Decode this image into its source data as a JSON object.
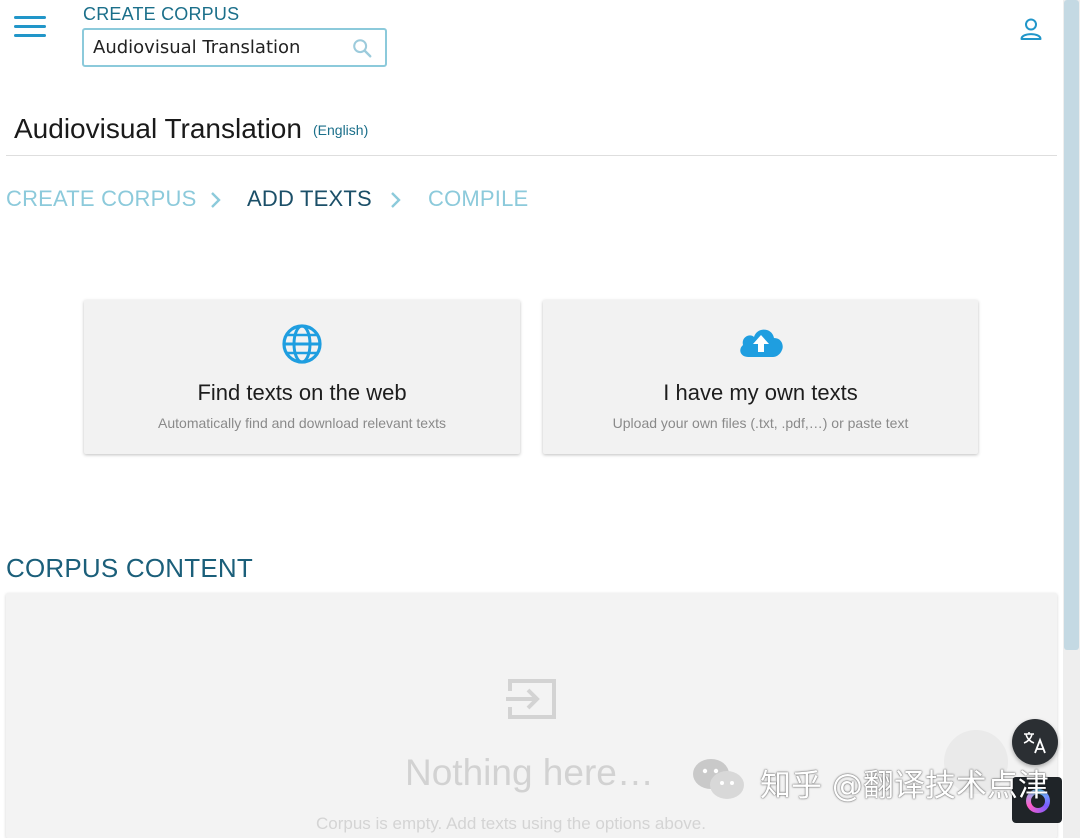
{
  "header": {
    "title": "CREATE CORPUS",
    "search": {
      "value": "Audiovisual Translation",
      "placeholder": ""
    }
  },
  "page": {
    "title": "Audiovisual Translation",
    "language": "(English)"
  },
  "stepper": {
    "steps": [
      {
        "label": "CREATE CORPUS",
        "state": "done"
      },
      {
        "label": "ADD TEXTS",
        "state": "active"
      },
      {
        "label": "COMPILE",
        "state": "pending"
      }
    ]
  },
  "options": [
    {
      "icon": "globe-icon",
      "title": "Find texts on the web",
      "subtitle": "Automatically find and download relevant texts"
    },
    {
      "icon": "cloud-upload-icon",
      "title": "I have my own texts",
      "subtitle": "Upload your own files (.txt, .pdf,…) or paste text"
    }
  ],
  "corpus": {
    "heading": "CORPUS CONTENT",
    "empty_title": "Nothing here…",
    "empty_subtitle": "Corpus is empty. Add texts using the options above."
  },
  "watermark": {
    "text": "公众号 · 翻译技术点津",
    "overlay": "知乎 @翻译技术点津"
  },
  "colors": {
    "accent": "#2196c9",
    "step_inactive": "#8ccadb",
    "step_active": "#1b4f68",
    "heading": "#1b5f7a"
  }
}
